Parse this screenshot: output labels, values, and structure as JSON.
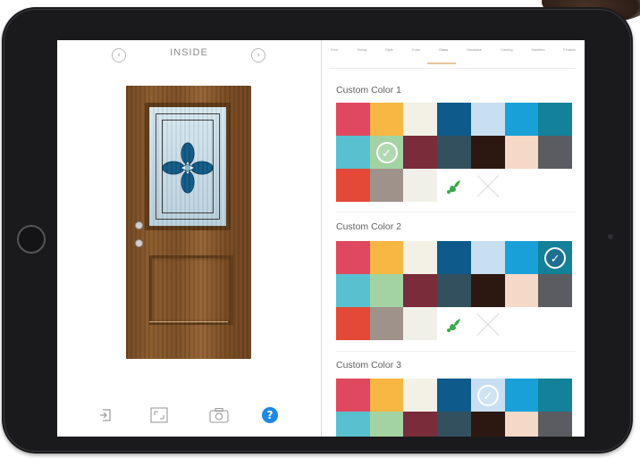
{
  "left_panel": {
    "title": "INSIDE",
    "prev_icon": "chevron-left-icon",
    "next_icon": "chevron-right-icon",
    "toolbar": [
      {
        "name": "exit-icon",
        "glyph": "⍈"
      },
      {
        "name": "fullscreen-icon",
        "glyph": "⤢"
      },
      {
        "name": "camera-icon",
        "glyph": "📷"
      },
      {
        "name": "help-icon",
        "glyph": "?"
      }
    ]
  },
  "tabs": {
    "items": [
      "Door",
      "Sizing",
      "Style",
      "Color",
      "Glass",
      "Hardware",
      "Caming",
      "Sidelites",
      "Finalize"
    ],
    "active_index": 4
  },
  "colors": {
    "accent_tab": "#e9c49a",
    "help_blue": "#1e88e5",
    "check_teal": "#1d6f91"
  },
  "sections": [
    {
      "title": "Custom Color 1",
      "selected_index": 8,
      "check_style": "light",
      "swatches": [
        "#e0485f",
        "#f8b643",
        "#f3f1e5",
        "#0e5a8a",
        "#c7dff0",
        "#1aa0d8",
        "#138199",
        "#58c0cf",
        "#a4d3a3",
        "#7a2c3a",
        "#33505e",
        "#2c1810",
        "#f6d8c6",
        "#5a5c61",
        "#e44836",
        "#9f928a",
        "#f1f0e8",
        "brush",
        "none"
      ]
    },
    {
      "title": "Custom Color 2",
      "selected_index": 6,
      "check_style": "dark",
      "swatches": [
        "#e0485f",
        "#f8b643",
        "#f3f1e5",
        "#0e5a8a",
        "#c7dff0",
        "#1aa0d8",
        "#138199",
        "#58c0cf",
        "#a4d3a3",
        "#7a2c3a",
        "#33505e",
        "#2c1810",
        "#f6d8c6",
        "#5a5c61",
        "#e44836",
        "#9f928a",
        "#f1f0e8",
        "brush",
        "none"
      ]
    },
    {
      "title": "Custom Color 3",
      "selected_index": 4,
      "check_style": "light",
      "swatches": [
        "#e0485f",
        "#f8b643",
        "#f3f1e5",
        "#0e5a8a",
        "#c7dff0",
        "#1aa0d8",
        "#138199",
        "#58c0cf",
        "#a4d3a3",
        "#7a2c3a",
        "#33505e",
        "#2c1810",
        "#f6d8c6",
        "#5a5c61"
      ]
    }
  ]
}
